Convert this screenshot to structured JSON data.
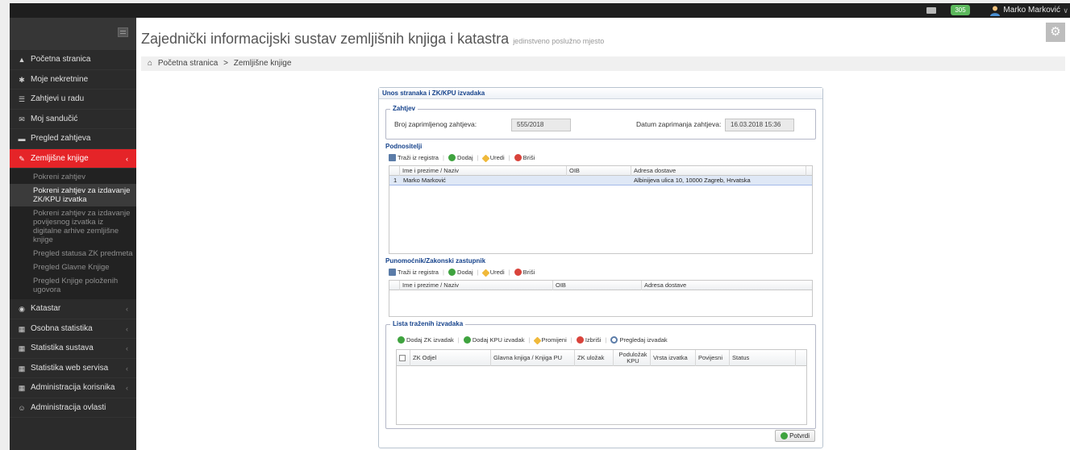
{
  "topbar": {
    "badge": "305",
    "user_name": "Marko Marković",
    "caret": "∨"
  },
  "sidebar": {
    "items": [
      {
        "label": "Početna stranica",
        "icon": "arrow-up-icon"
      },
      {
        "label": "Moje nekretnine",
        "icon": "asterisk-icon"
      },
      {
        "label": "Zahtjevi u radu",
        "icon": "list-icon"
      },
      {
        "label": "Moj sandučić",
        "icon": "envelope-icon"
      },
      {
        "label": "Pregled zahtjeva",
        "icon": "folder-icon"
      },
      {
        "label": "Zemljišne knjige",
        "icon": "wrench-icon",
        "active": true
      }
    ],
    "submenu": [
      "Pokreni zahtjev",
      "Pokreni zahtjev za izdavanje ZK/KPU izvatka",
      "Pokreni zahtjev za izdavanje povijesnog izvatka iz digitalne arhive zemljišne knjige",
      "Pregled statusa ZK predmeta",
      "Pregled Glavne Knjige",
      "Pregled Knjige položenih ugovora"
    ],
    "items_after": [
      {
        "label": "Katastar",
        "icon": "globe-icon"
      },
      {
        "label": "Osobna statistika",
        "icon": "chart-icon"
      },
      {
        "label": "Statistika sustava",
        "icon": "chart-icon"
      },
      {
        "label": "Statistika web servisa",
        "icon": "chart-icon"
      },
      {
        "label": "Administracija korisnika",
        "icon": "chart-icon"
      },
      {
        "label": "Administracija ovlasti",
        "icon": "users-icon"
      }
    ]
  },
  "main": {
    "title": "Zajednički informacijski sustav zemljišnih knjiga i katastra",
    "subtitle": "jedinstveno poslužno mjesto",
    "breadcrumb": [
      "Početna stranica",
      ">",
      "Zemljišne knjige"
    ]
  },
  "dialog": {
    "title": "Unos stranaka i ZK/KPU izvadaka",
    "zahtjev": {
      "legend": "Zahtjev",
      "broj_label": "Broj zaprimljenog zahtjeva:",
      "broj_value": "555/2018",
      "datum_label": "Datum zaprimanja zahtjeva:",
      "datum_value": "16.03.2018 15:36"
    },
    "podnositelji": {
      "title": "Podnositelji",
      "toolbar": [
        "Traži iz registra",
        "Dodaj",
        "Uredi",
        "Briši"
      ],
      "columns": [
        "Ime i prezime / Naziv",
        "OIB",
        "Adresa dostave"
      ],
      "rows": [
        {
          "num": "1",
          "name": "Marko Marković",
          "oib": "",
          "address": "Albinijeva ulica 10, 10000 Zagreb, Hrvatska"
        }
      ]
    },
    "punomocnik": {
      "title": "Punomoćnik/Zakonski zastupnik",
      "toolbar": [
        "Traži iz registra",
        "Dodaj",
        "Uredi",
        "Briši"
      ],
      "columns": [
        "Ime i prezime / Naziv",
        "OIB",
        "Adresa dostave"
      ]
    },
    "izvadci": {
      "legend": "Lista traženih izvadaka",
      "toolbar": [
        "Dodaj ZK izvadak",
        "Dodaj KPU izvadak",
        "Promijeni",
        "Izbriši",
        "Pregledaj izvadak"
      ],
      "columns": [
        "ZK Odjel",
        "Glavna knjiga / Knjiga PU",
        "ZK uložak",
        "Poduložak KPU",
        "Vrsta izvatka",
        "Povijesni",
        "Status"
      ]
    },
    "confirm_label": "Potvrdi"
  }
}
